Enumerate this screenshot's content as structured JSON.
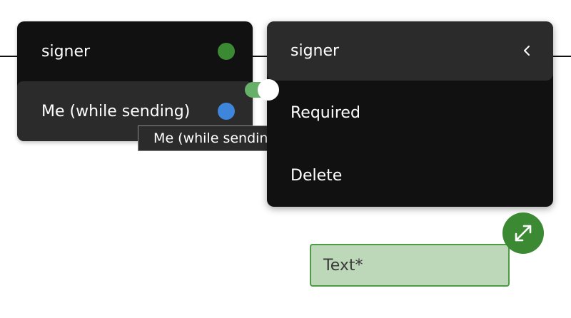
{
  "colors": {
    "signer_dot": "#3b8a33",
    "me_dot": "#3d86dc",
    "toggle_on": "#66b06a",
    "field_fill": "#bdd8b8",
    "field_border": "#4e9a45",
    "expand_button": "#3b8a33"
  },
  "left_menu": {
    "items": [
      {
        "label": "signer",
        "dot_color": "#3b8a33"
      },
      {
        "label": "Me (while sending)",
        "dot_color": "#3d86dc"
      }
    ]
  },
  "tooltip": {
    "text": "Me (while sending)"
  },
  "right_panel": {
    "header_label": "signer",
    "back_icon": "chevron-left-icon",
    "required_label": "Required",
    "required_on": true,
    "delete_label": "Delete"
  },
  "field": {
    "label": "Text*",
    "expand_icon": "expand-arrows-icon"
  }
}
